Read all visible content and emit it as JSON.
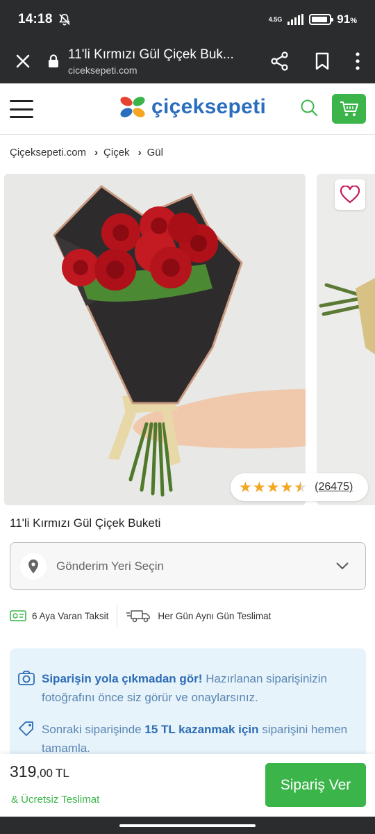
{
  "status_bar": {
    "time": "14:18",
    "network": "4.5G",
    "battery": "91",
    "battery_unit": "%",
    "battery_level": 0.91
  },
  "browser": {
    "page_title": "11'li Kırmızı Gül Çiçek Buk...",
    "domain": "ciceksepeti.com"
  },
  "header": {
    "logo_text": "çiçeksepeti"
  },
  "breadcrumb": [
    "Çiçeksepeti.com",
    "Çiçek",
    "Gül"
  ],
  "product": {
    "rating": 4.5,
    "review_count": "(26475)",
    "name": "11'li Kırmızı Gül Çiçek Buketi"
  },
  "delivery": {
    "placeholder": "Gönderim Yeri Seçin"
  },
  "features": [
    "6 Aya Varan Taksit",
    "Her Gün Aynı Gün Teslimat"
  ],
  "info": {
    "photo_bold": "Siparişin yola çıkmadan gör!",
    "photo_text": " Hazırlanan siparişinizin fotoğrafını önce siz görür ve onaylarsınız.",
    "promo_pre": "Sonraki siparişinde ",
    "promo_bold": "15 TL kazanmak için",
    "promo_post": " siparişini hemen tamamla."
  },
  "checkout": {
    "price_main": "319",
    "price_decimal": ",00",
    "currency": "TL",
    "free_delivery": "& Ücretsiz Teslimat",
    "order_button": "Sipariş Ver"
  },
  "colors": {
    "brand_green": "#3bb54a",
    "brand_blue": "#2a6ebd",
    "info_bg": "#e7f3fb",
    "star": "#f5a623",
    "chrome_bar": "#2b2c2e"
  }
}
